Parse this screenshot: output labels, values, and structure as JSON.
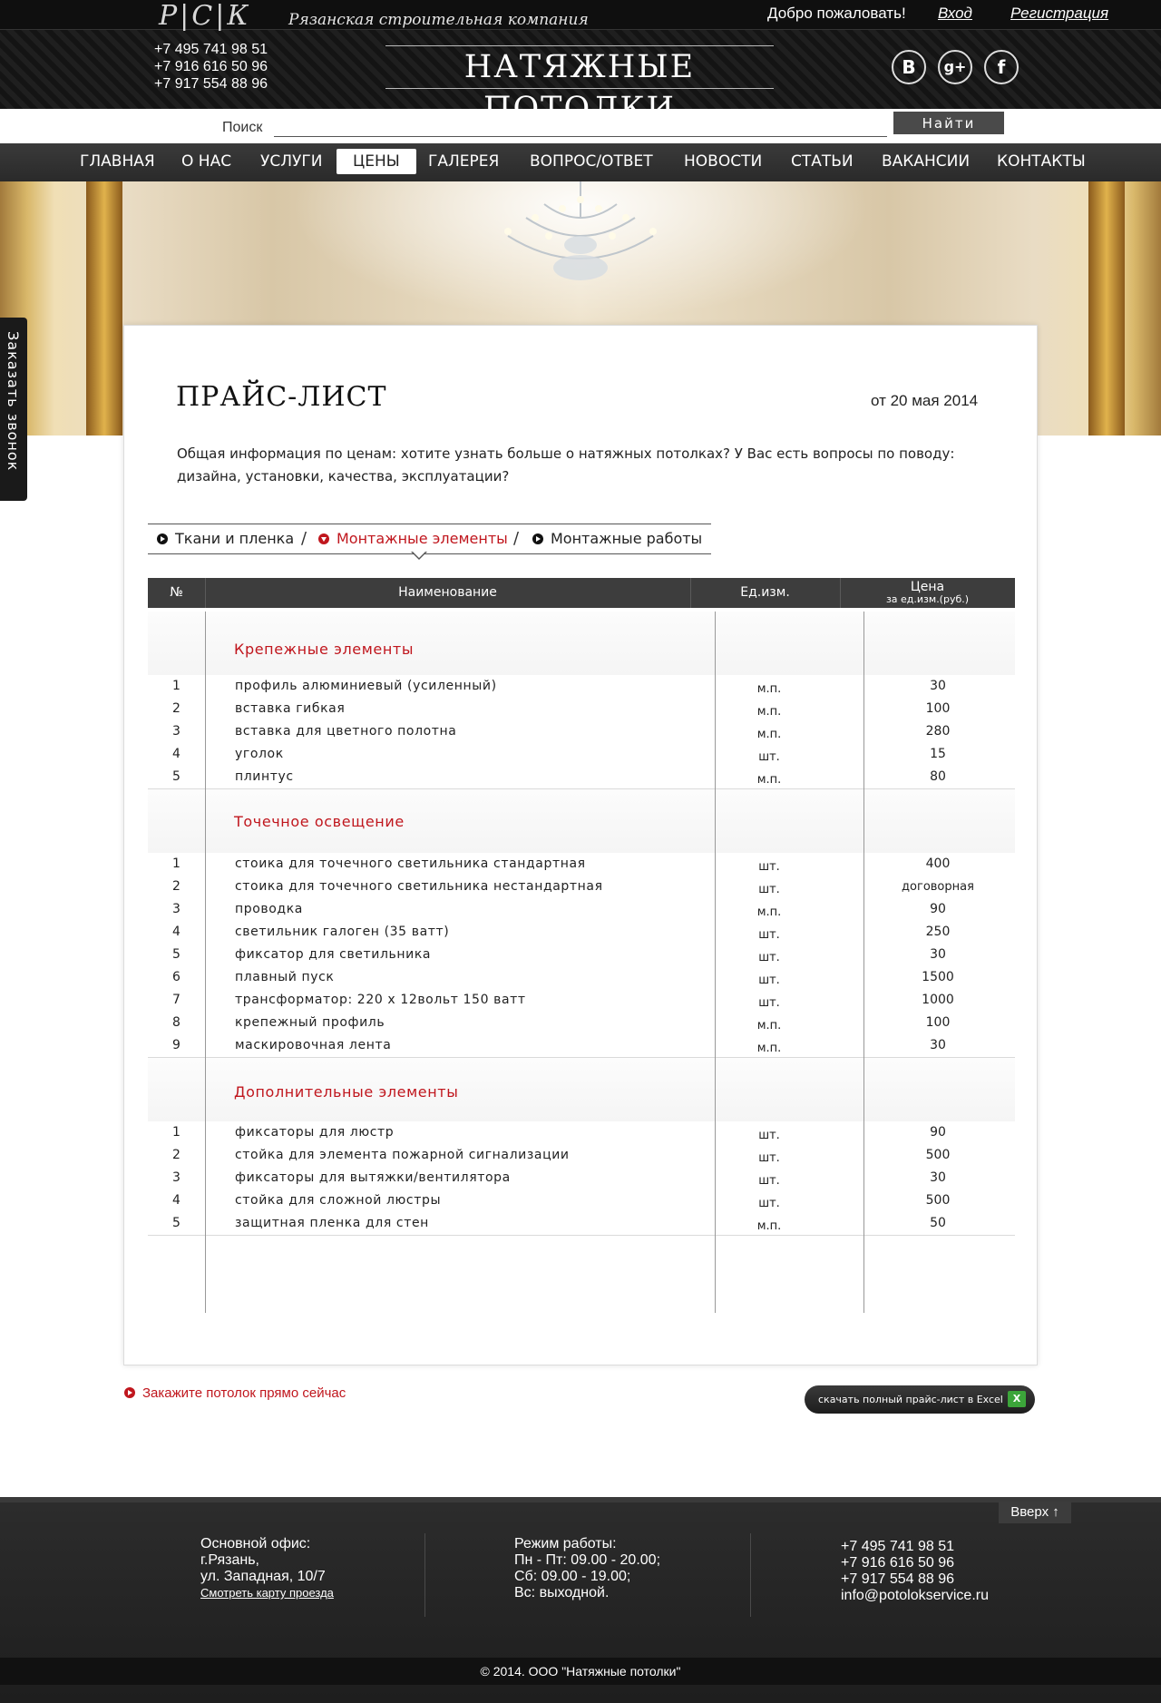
{
  "header": {
    "logo": "Р|С|К",
    "tagline": "Рязанская строительная компания",
    "welcome": "Добро пожаловать!",
    "login": "Вход",
    "register": "Регистрация",
    "phones": [
      "+7 495 741 98 51",
      "+7 916 616 50 96",
      "+7 917 554 88 96"
    ],
    "site_title": "НАТЯЖНЫЕ ПОТОЛКИ",
    "social": [
      "vk-icon",
      "google-plus-icon",
      "facebook-icon"
    ]
  },
  "search": {
    "label": "Поиск",
    "value": "",
    "button": "Найти"
  },
  "nav": {
    "items": [
      "ГЛАВНАЯ",
      "О НАС",
      "УСЛУГИ",
      "ЦЕНЫ",
      "ГАЛЕРЕЯ",
      "ВОПРОС/ОТВЕТ",
      "НОВОСТИ",
      "СТАТЬИ",
      "ВАКАНСИИ",
      "КОНТАКТЫ"
    ],
    "active": "ЦЕНЫ"
  },
  "callback_tab": "Заказать звонок",
  "page": {
    "title": "ПРАЙС-ЛИСТ",
    "date": "от 20 мая 2014",
    "intro": "Общая информация по ценам: хотите узнать больше о натяжных потолках? У Вас есть вопросы по поводу: дизайна, установки, качества, эксплуатации?"
  },
  "tabs": {
    "items": [
      "Ткани и пленка",
      "Монтажные элементы",
      "Монтажные работы"
    ],
    "separator": "/",
    "active": "Монтажные элементы"
  },
  "table": {
    "headers": {
      "num": "№",
      "name": "Наименование",
      "unit": "Ед.изм.",
      "price": "Цена",
      "price_sub": "за ед.изм.(руб.)"
    },
    "sections": [
      {
        "title": "Крепежные элементы",
        "rows": [
          [
            "1",
            "профиль алюминиевый (усиленный)",
            "м.п.",
            "30"
          ],
          [
            "2",
            "вставка гибкая",
            "м.п.",
            "100"
          ],
          [
            "3",
            "вставка для цветного полотна",
            "м.п.",
            "280"
          ],
          [
            "4",
            "уголок",
            "шт.",
            "15"
          ],
          [
            "5",
            "плинтус",
            "м.п.",
            "80"
          ]
        ]
      },
      {
        "title": "Точечное освещение",
        "rows": [
          [
            "1",
            "стоика для точечного светильника стандартная",
            "шт.",
            "400"
          ],
          [
            "2",
            "стоика для точечного светильника нестандартная",
            "шт.",
            "договорная"
          ],
          [
            "3",
            "проводка",
            "м.п.",
            "90"
          ],
          [
            "4",
            "светильник галоген (35 ватт)",
            "шт.",
            "250"
          ],
          [
            "5",
            "фиксатор для светильника",
            "шт.",
            "30"
          ],
          [
            "6",
            "плавный пуск",
            "шт.",
            "1500"
          ],
          [
            "7",
            "трансформатор: 220 х 12вольт 150 ватт",
            "шт.",
            "1000"
          ],
          [
            "8",
            "крепежный профиль",
            "м.п.",
            "100"
          ],
          [
            "9",
            "маскировочная лента",
            "м.п.",
            "30"
          ]
        ]
      },
      {
        "title": "Дополнительные элементы",
        "rows": [
          [
            "1",
            "фиксаторы для люстр",
            "шт.",
            "90"
          ],
          [
            "2",
            "стойка для элемента пожарной сигнализации",
            "шт.",
            "500"
          ],
          [
            "3",
            "фиксаторы для вытяжки/вентилятора",
            "шт.",
            "30"
          ],
          [
            "4",
            "стойка  для сложной люстры",
            "шт.",
            "500"
          ],
          [
            "5",
            "защитная пленка для стен",
            "м.п.",
            "50"
          ]
        ]
      }
    ]
  },
  "actions": {
    "order": "Закажите потолок прямо сейчас",
    "download": "скачать полный прайс-лист в Excel"
  },
  "footer": {
    "up": "Вверх ↑",
    "office_title": "Основной офис:",
    "office_lines": [
      "г.Рязань,",
      "ул. Западная, 10/7"
    ],
    "map_link": "Смотреть карту проезда",
    "hours_title": "Режим работы:",
    "hours_lines": [
      "Пн - Пт: 09.00 - 20.00;",
      "Сб: 09.00 - 19.00;",
      "Вс: выходной."
    ],
    "contacts": [
      "+7 495 741 98 51",
      "+7 916 616 50 96",
      "+7 917 554 88 96",
      "info@potolokservice.ru"
    ],
    "copyright": "© 2014. ООО \"Натяжные потолки\""
  },
  "colors": {
    "accent": "#c0161d",
    "dark": "#1a1a1a",
    "table_header": "#3d3d3d"
  }
}
